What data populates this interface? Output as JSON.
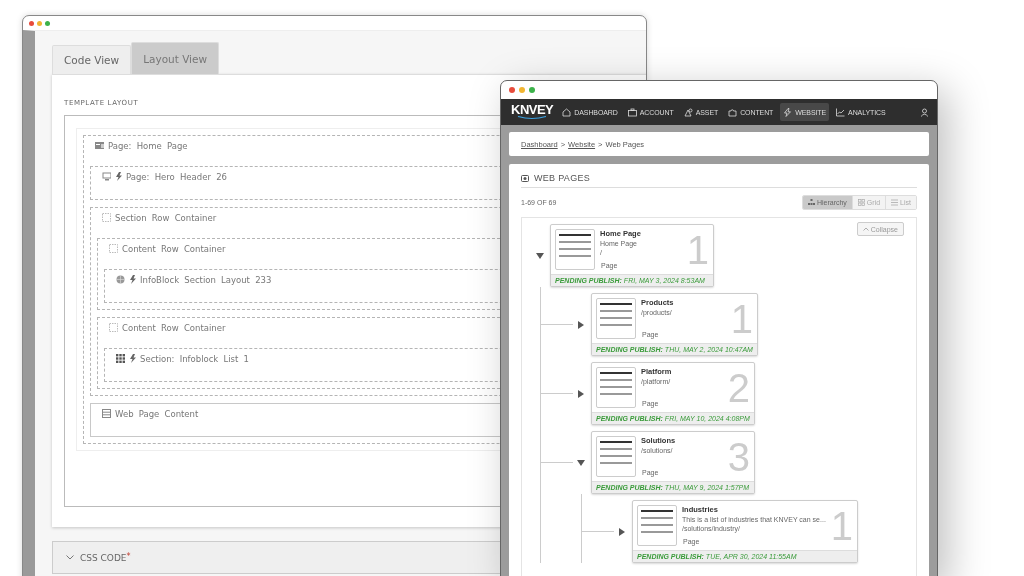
{
  "back_window": {
    "tabs": [
      {
        "label": "Code View",
        "selected": false
      },
      {
        "label": "Layout View",
        "selected": true
      }
    ],
    "section_title": "TEMPLATE LAYOUT",
    "layout_tree": [
      {
        "kind": "page",
        "label": "Page: Home Page",
        "dynamic": false,
        "children": [
          {
            "kind": "component",
            "label": "Page: Hero Header 26",
            "dynamic": true
          },
          {
            "kind": "container",
            "label": "Section Row Container",
            "dynamic": false,
            "children": [
              {
                "kind": "container",
                "label": "Content Row Container",
                "dynamic": false,
                "children": [
                  {
                    "kind": "infoblock",
                    "label": "InfoBlock Section Layout 233",
                    "dynamic": true
                  }
                ]
              },
              {
                "kind": "container",
                "label": "Content Row Container",
                "dynamic": false,
                "children": [
                  {
                    "kind": "list",
                    "label": "Section: Infoblock List 1",
                    "dynamic": true
                  }
                ]
              }
            ]
          },
          {
            "kind": "content",
            "label": "Web Page Content",
            "dynamic": false
          }
        ]
      }
    ],
    "css_panel": {
      "label": "CSS CODE",
      "required_mark": "*"
    }
  },
  "front_window": {
    "logo": "KNVEY",
    "nav": [
      {
        "label": "DASHBOARD",
        "selected": false
      },
      {
        "label": "ACCOUNT",
        "selected": false
      },
      {
        "label": "ASSET",
        "selected": false
      },
      {
        "label": "CONTENT",
        "selected": false
      },
      {
        "label": "WEBSITE",
        "selected": true
      },
      {
        "label": "ANALYTICS",
        "selected": false
      }
    ],
    "breadcrumb": [
      {
        "kind": "link",
        "label": "Dashboard"
      },
      {
        "kind": "separator",
        "label": ">"
      },
      {
        "kind": "link",
        "label": "Website"
      },
      {
        "kind": "separator",
        "label": ">"
      },
      {
        "kind": "current",
        "label": "Web Pages"
      }
    ],
    "heading": "WEB PAGES",
    "count": "1-69 OF 69",
    "view_modes": [
      {
        "label": "Hierarchy",
        "selected": true
      },
      {
        "label": "Grid",
        "selected": false
      },
      {
        "label": "List",
        "selected": false
      }
    ],
    "collapse_button": "Collapse",
    "pages": [
      {
        "title": "Home Page",
        "subtitle": "Home Page",
        "path": "/",
        "type": "Page",
        "number": "1",
        "status": "**PENDING PUBLISH:** FRI, MAY 3, 2024 8:53AM",
        "expanded": true,
        "children": [
          {
            "title": "Products",
            "path": "/products/",
            "type": "Page",
            "number": "1",
            "status": "**PENDING PUBLISH:** THU, MAY 2, 2024 10:47AM",
            "expanded": false
          },
          {
            "title": "Platform",
            "path": "/platform/",
            "type": "Page",
            "number": "2",
            "status": "**PENDING PUBLISH:** FRI, MAY 10, 2024 4:08PM",
            "expanded": false
          },
          {
            "title": "Solutions",
            "path": "/solutions/",
            "type": "Page",
            "number": "3",
            "status": "**PENDING PUBLISH:** THU, MAY 9, 2024 1:57PM",
            "expanded": true,
            "children": [
              {
                "title": "Industries",
                "description": "This is a list of industries that KNVEY can se...",
                "path": "/solutions/industry/",
                "type": "Page",
                "number": "1",
                "status": "**PENDING PUBLISH:** TUE, APR 30, 2024 11:55AM",
                "expanded": false
              }
            ]
          }
        ]
      }
    ]
  }
}
